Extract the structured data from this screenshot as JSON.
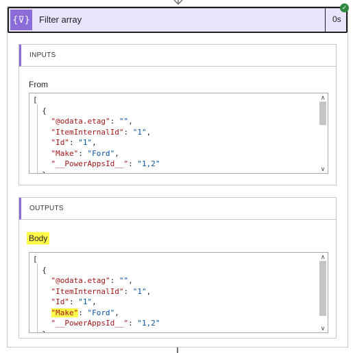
{
  "header": {
    "title": "Filter array",
    "duration": "0s",
    "icon_glyph": "{⊽}",
    "status_glyph": "✓",
    "accent_color": "#8c6cd8",
    "header_bg": "#e8e4fb",
    "status_color": "#2e8a3e"
  },
  "inputs": {
    "section_title": "INPUTS",
    "field_label": "From",
    "code": {
      "open_bracket": "[",
      "open_brace": "{",
      "lines": [
        {
          "key": "\"@odata.etag\"",
          "sep": ": ",
          "value": "\"\"",
          "trail": ","
        },
        {
          "key": "\"ItemInternalId\"",
          "sep": ": ",
          "value": "\"1\"",
          "trail": ","
        },
        {
          "key": "\"Id\"",
          "sep": ": ",
          "value": "\"1\"",
          "trail": ","
        },
        {
          "key": "\"Make\"",
          "sep": ": ",
          "value": "\"Ford\"",
          "trail": ","
        },
        {
          "key": "\"__PowerAppsId__\"",
          "sep": ": ",
          "value": "\"1,2\"",
          "trail": ""
        }
      ],
      "close_brace": "},"
    }
  },
  "outputs": {
    "section_title": "OUTPUTS",
    "field_label": "Body",
    "code": {
      "open_bracket": "[",
      "open_brace": "{",
      "lines": [
        {
          "key": "\"@odata.etag\"",
          "sep": ": ",
          "value": "\"\"",
          "trail": ","
        },
        {
          "key": "\"ItemInternalId\"",
          "sep": ": ",
          "value": "\"1\"",
          "trail": ","
        },
        {
          "key": "\"Id\"",
          "sep": ": ",
          "value": "\"1\"",
          "trail": ","
        },
        {
          "key": "\"Make\"",
          "sep": ": ",
          "value": "\"Ford\"",
          "trail": ","
        },
        {
          "key": "\"__PowerAppsId__\"",
          "sep": ": ",
          "value": "\"1,2\"",
          "trail": ""
        }
      ],
      "close_brace": "},"
    }
  },
  "scroll": {
    "up_glyph": "∧",
    "down_glyph": "∨"
  }
}
